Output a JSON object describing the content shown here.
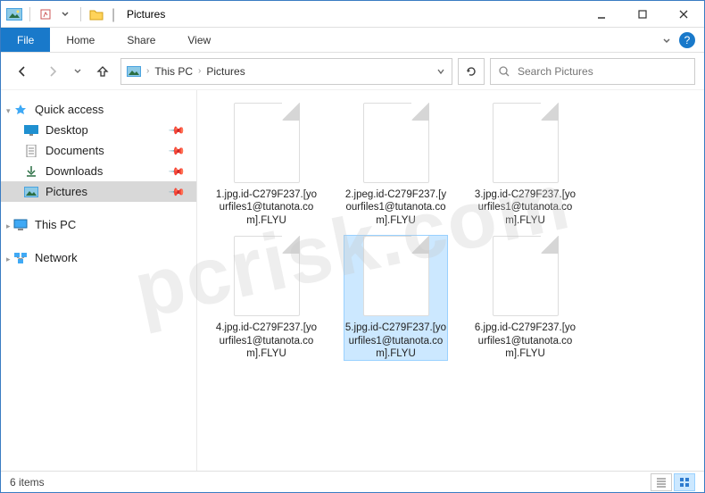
{
  "title": "Pictures",
  "ribbon": {
    "file": "File",
    "tabs": [
      "Home",
      "Share",
      "View"
    ]
  },
  "breadcrumbs": [
    "This PC",
    "Pictures"
  ],
  "search": {
    "placeholder": "Search Pictures"
  },
  "sidebar": {
    "quickAccess": "Quick access",
    "items": [
      {
        "label": "Desktop",
        "pinned": true
      },
      {
        "label": "Documents",
        "pinned": true
      },
      {
        "label": "Downloads",
        "pinned": true
      },
      {
        "label": "Pictures",
        "pinned": true,
        "selected": true
      }
    ],
    "thisPC": "This PC",
    "network": "Network"
  },
  "files": [
    {
      "name": "1.jpg.id-C279F237.[yourfiles1@tutanota.com].FLYU"
    },
    {
      "name": "2.jpeg.id-C279F237.[yourfiles1@tutanota.com].FLYU"
    },
    {
      "name": "3.jpg.id-C279F237.[yourfiles1@tutanota.com].FLYU"
    },
    {
      "name": "4.jpg.id-C279F237.[yourfiles1@tutanota.com].FLYU"
    },
    {
      "name": "5.jpg.id-C279F237.[yourfiles1@tutanota.com].FLYU",
      "selected": true
    },
    {
      "name": "6.jpg.id-C279F237.[yourfiles1@tutanota.com].FLYU"
    }
  ],
  "status": {
    "count": "6 items"
  },
  "watermark": "pcrisk.com"
}
